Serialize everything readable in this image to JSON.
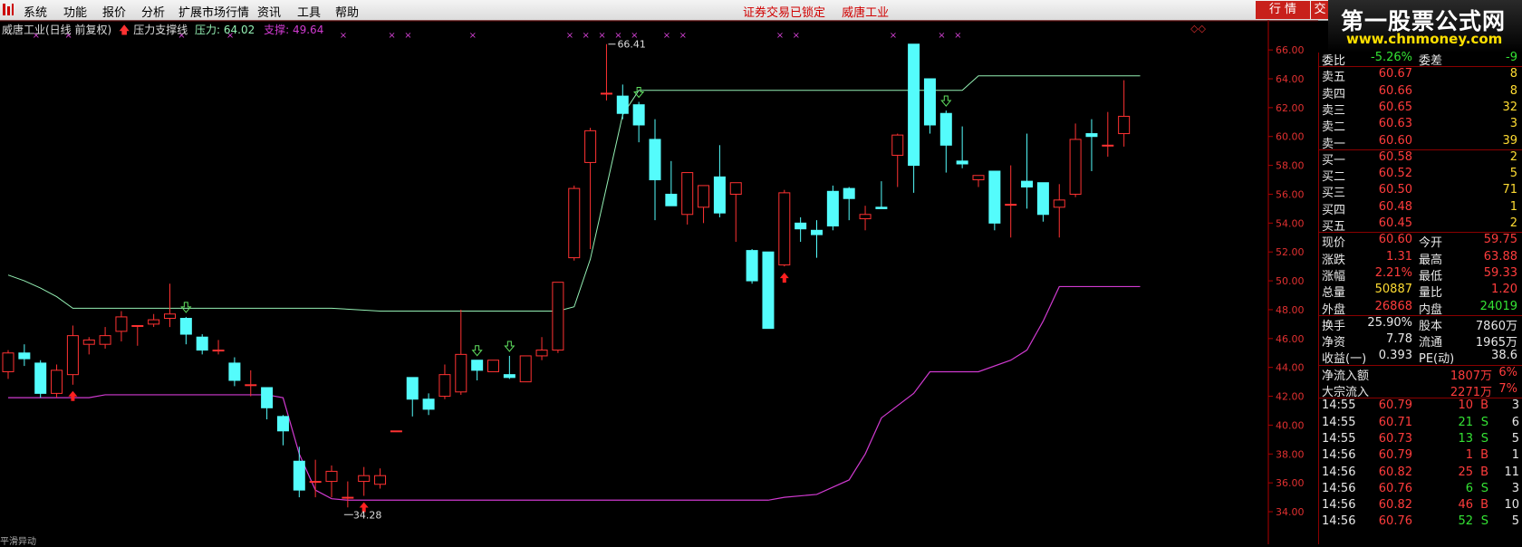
{
  "menu": [
    {
      "label": "系统"
    },
    {
      "label": "功能"
    },
    {
      "label": "报价"
    },
    {
      "label": "分析"
    },
    {
      "label": "扩展市场行情"
    },
    {
      "label": "资讯"
    },
    {
      "label": "工具"
    },
    {
      "label": "帮助"
    }
  ],
  "status": {
    "lock": "证券交易已锁定",
    "stock": "威唐工业"
  },
  "top_tabs": {
    "quote": "行 情",
    "trade": "交"
  },
  "watermark": {
    "title": "第一股票公式网",
    "url": "www.chnmoney.com"
  },
  "chart_header": {
    "stock": "威唐工业(日线 前复权)",
    "indicator": "压力支撑线",
    "pressure_label": "压力:",
    "pressure_value": "64.02",
    "support_label": "支撑:",
    "support_value": "49.64"
  },
  "indicator_nav": "◇◇",
  "colors": {
    "up": "#ff3232",
    "down": "#54fcfc",
    "pressure": "#94f0b4",
    "support": "#d03ad0",
    "axis": "#b00000"
  },
  "chart_data": {
    "type": "candlestick",
    "ylim": [
      33.5,
      67.2
    ],
    "yticks": [
      "66.00",
      "64.00",
      "62.00",
      "60.00",
      "58.00",
      "56.00",
      "54.00",
      "52.00",
      "50.00",
      "48.00",
      "46.00",
      "44.00",
      "42.00",
      "40.00",
      "38.00",
      "36.00",
      "34.00"
    ],
    "annotations": [
      {
        "text": "66.41",
        "index": 37
      },
      {
        "text": "34.28",
        "index": 21
      }
    ],
    "candles": [
      [
        43.7,
        45.2,
        43.2,
        45.0
      ],
      [
        45.0,
        45.6,
        44.1,
        44.6
      ],
      [
        44.3,
        44.5,
        41.9,
        42.2
      ],
      [
        42.2,
        44.2,
        41.9,
        43.8
      ],
      [
        43.5,
        46.9,
        42.8,
        46.2
      ],
      [
        45.6,
        46.1,
        44.9,
        45.9
      ],
      [
        45.6,
        46.8,
        45.3,
        46.2
      ],
      [
        46.5,
        47.9,
        45.8,
        47.5
      ],
      [
        46.9,
        46.9,
        45.5,
        46.9
      ],
      [
        47.0,
        47.7,
        46.8,
        47.3
      ],
      [
        47.4,
        49.8,
        46.8,
        47.7
      ],
      [
        47.4,
        47.5,
        45.6,
        46.3
      ],
      [
        46.1,
        46.3,
        44.9,
        45.2
      ],
      [
        45.2,
        45.9,
        44.9,
        45.2
      ],
      [
        44.3,
        44.7,
        42.7,
        43.1
      ],
      [
        42.8,
        43.8,
        42.0,
        42.8
      ],
      [
        42.6,
        42.6,
        40.4,
        41.2
      ],
      [
        40.6,
        40.7,
        38.6,
        39.6
      ],
      [
        37.5,
        38.5,
        35.0,
        35.5
      ],
      [
        36.1,
        37.6,
        35.0,
        36.1
      ],
      [
        36.1,
        37.2,
        35.0,
        36.8
      ],
      [
        35.0,
        36.1,
        34.3,
        35.0
      ],
      [
        36.1,
        37.1,
        35.1,
        36.5
      ],
      [
        35.9,
        37.0,
        35.6,
        36.5
      ],
      [
        39.6,
        39.6,
        39.6,
        39.6
      ],
      [
        43.3,
        43.3,
        40.6,
        41.8
      ],
      [
        41.8,
        42.2,
        40.7,
        41.1
      ],
      [
        42.0,
        44.2,
        41.8,
        43.5
      ],
      [
        42.3,
        48.0,
        42.1,
        44.9
      ],
      [
        44.5,
        44.5,
        43.1,
        43.8
      ],
      [
        43.7,
        44.5,
        43.7,
        44.5
      ],
      [
        43.5,
        44.8,
        43.2,
        43.3
      ],
      [
        43.0,
        44.4,
        43.0,
        44.8
      ],
      [
        44.8,
        46.1,
        44.5,
        45.2
      ],
      [
        45.2,
        49.9,
        45.0,
        49.9
      ],
      [
        51.6,
        56.6,
        51.4,
        56.4
      ],
      [
        58.2,
        60.6,
        52.2,
        60.4
      ],
      [
        63.0,
        66.4,
        62.5,
        63.0
      ],
      [
        62.8,
        63.6,
        61.2,
        61.6
      ],
      [
        62.2,
        62.4,
        59.6,
        60.8
      ],
      [
        59.8,
        61.2,
        54.2,
        57.0
      ],
      [
        56.0,
        58.3,
        55.3,
        55.2
      ],
      [
        54.6,
        57.2,
        53.9,
        57.5
      ],
      [
        55.1,
        56.5,
        54.0,
        56.6
      ],
      [
        57.2,
        59.4,
        54.4,
        54.7
      ],
      [
        56.0,
        56.6,
        52.7,
        56.8
      ],
      [
        52.1,
        52.2,
        49.8,
        50.0
      ],
      [
        52.0,
        52.0,
        46.7,
        46.7
      ],
      [
        51.1,
        56.3,
        51.0,
        56.1
      ],
      [
        54.0,
        54.4,
        52.7,
        53.6
      ],
      [
        53.5,
        54.2,
        51.6,
        53.2
      ],
      [
        56.2,
        56.6,
        53.5,
        53.8
      ],
      [
        56.4,
        56.5,
        54.2,
        55.7
      ],
      [
        54.3,
        55.2,
        53.5,
        54.6
      ],
      [
        55.1,
        56.9,
        55.0,
        55.0
      ],
      [
        58.7,
        60.2,
        56.5,
        60.1
      ],
      [
        66.4,
        66.4,
        56.1,
        58.0
      ],
      [
        64.0,
        64.0,
        60.2,
        60.8
      ],
      [
        61.6,
        61.8,
        57.5,
        59.4
      ],
      [
        58.3,
        60.7,
        57.8,
        58.1
      ],
      [
        57.0,
        57.0,
        56.5,
        57.3
      ],
      [
        57.6,
        57.6,
        53.5,
        54.0
      ],
      [
        55.3,
        58.0,
        53.0,
        55.3
      ],
      [
        56.9,
        60.2,
        55.0,
        56.5
      ],
      [
        56.8,
        56.8,
        54.1,
        54.6
      ],
      [
        55.1,
        56.7,
        53.0,
        55.6
      ],
      [
        56.0,
        60.9,
        55.8,
        59.8
      ],
      [
        60.2,
        61.2,
        57.6,
        60.0
      ],
      [
        59.4,
        61.7,
        58.6,
        59.4
      ],
      [
        60.2,
        63.9,
        59.3,
        61.4
      ]
    ],
    "pressure_line": [
      [
        0,
        50.4
      ],
      [
        1,
        50.0
      ],
      [
        2,
        49.5
      ],
      [
        3,
        48.9
      ],
      [
        4,
        48.1
      ],
      [
        5,
        48.1
      ],
      [
        10,
        48.1
      ],
      [
        20,
        48.1
      ],
      [
        23,
        47.9
      ],
      [
        34,
        47.9
      ],
      [
        35,
        48.2
      ],
      [
        36,
        51.5
      ],
      [
        37,
        56.5
      ],
      [
        38,
        61.5
      ],
      [
        39,
        63.2
      ],
      [
        55,
        63.2
      ],
      [
        58,
        63.2
      ],
      [
        59,
        63.2
      ],
      [
        60,
        64.2
      ],
      [
        70,
        64.2
      ]
    ],
    "support_line": [
      [
        0,
        41.9
      ],
      [
        5,
        41.9
      ],
      [
        6,
        42.1
      ],
      [
        10,
        42.1
      ],
      [
        16,
        42.1
      ],
      [
        17,
        41.9
      ],
      [
        18,
        38.0
      ],
      [
        19,
        35.5
      ],
      [
        20,
        34.9
      ],
      [
        21,
        34.8
      ],
      [
        47,
        34.8
      ],
      [
        48,
        35.0
      ],
      [
        50,
        35.2
      ],
      [
        51,
        35.7
      ],
      [
        52,
        36.2
      ],
      [
        53,
        38.0
      ],
      [
        54,
        40.5
      ],
      [
        56,
        42.2
      ],
      [
        57,
        43.7
      ],
      [
        60,
        43.7
      ],
      [
        62,
        44.5
      ],
      [
        63,
        45.2
      ],
      [
        64,
        47.2
      ],
      [
        65,
        49.6
      ],
      [
        66,
        49.6
      ],
      [
        70,
        49.6
      ]
    ],
    "up_signals": [
      4,
      22,
      48
    ],
    "down_signals": [
      11,
      29,
      31,
      39,
      58
    ],
    "x_marks": [
      1,
      3,
      10,
      13,
      20,
      23,
      24,
      28,
      34,
      35,
      36,
      37,
      38,
      40,
      41,
      47,
      48,
      54,
      57,
      58
    ]
  },
  "panel": {
    "rows": [
      {
        "type": "ratio",
        "label": "委比",
        "value": "-5.26%",
        "label2": "委差",
        "value2": "-9"
      },
      {
        "type": "book",
        "label": "卖五",
        "price": "60.67",
        "qty": "8"
      },
      {
        "type": "book",
        "label": "卖四",
        "price": "60.66",
        "qty": "8"
      },
      {
        "type": "book",
        "label": "卖三",
        "price": "60.65",
        "qty": "32"
      },
      {
        "type": "book",
        "label": "卖二",
        "price": "60.63",
        "qty": "3"
      },
      {
        "type": "book",
        "label": "卖一",
        "price": "60.60",
        "qty": "39"
      },
      {
        "type": "book",
        "label": "买一",
        "price": "60.58",
        "qty": "2"
      },
      {
        "type": "book",
        "label": "买二",
        "price": "60.52",
        "qty": "5"
      },
      {
        "type": "book",
        "label": "买三",
        "price": "60.50",
        "qty": "71"
      },
      {
        "type": "book",
        "label": "买四",
        "price": "60.48",
        "qty": "1"
      },
      {
        "type": "book",
        "label": "买五",
        "price": "60.45",
        "qty": "2"
      },
      {
        "type": "kv2",
        "label": "现价",
        "value": "60.60",
        "label2": "今开",
        "value2": "59.75"
      },
      {
        "type": "kv2",
        "label": "涨跌",
        "value": "1.31",
        "label2": "最高",
        "value2": "63.88"
      },
      {
        "type": "kv2",
        "label": "涨幅",
        "value": "2.21%",
        "label2": "最低",
        "value2": "59.33"
      },
      {
        "type": "kv2",
        "label": "总量",
        "value": "50887",
        "label2": "量比",
        "value2": "1.20"
      },
      {
        "type": "kv2",
        "label": "外盘",
        "value": "26868",
        "label2": "内盘",
        "value2": "24019"
      },
      {
        "type": "kv2",
        "label": "换手",
        "value": "25.90%",
        "label2": "股本",
        "value2": "7860万"
      },
      {
        "type": "kv2",
        "label": "净资",
        "value": "7.78",
        "label2": "流通",
        "value2": "1965万"
      },
      {
        "type": "kv2",
        "label": "收益(一)",
        "value": "0.393",
        "label2": "PE(动)",
        "value2": "38.6"
      },
      {
        "type": "flow",
        "label": "净流入额",
        "value": "1807万",
        "pct": "6%"
      },
      {
        "type": "flow",
        "label": "大宗流入",
        "value": "2271万",
        "pct": "7%"
      },
      {
        "type": "tick",
        "time": "14:55",
        "price": "60.79",
        "vol": "10",
        "bs": "B",
        "n": "3"
      },
      {
        "type": "tick",
        "time": "14:55",
        "price": "60.71",
        "vol": "21",
        "bs": "S",
        "n": "6"
      },
      {
        "type": "tick",
        "time": "14:55",
        "price": "60.73",
        "vol": "13",
        "bs": "S",
        "n": "5"
      },
      {
        "type": "tick",
        "time": "14:56",
        "price": "60.79",
        "vol": "1",
        "bs": "B",
        "n": "1"
      },
      {
        "type": "tick",
        "time": "14:56",
        "price": "60.82",
        "vol": "25",
        "bs": "B",
        "n": "11"
      },
      {
        "type": "tick",
        "time": "14:56",
        "price": "60.76",
        "vol": "6",
        "bs": "S",
        "n": "3"
      },
      {
        "type": "tick",
        "time": "14:56",
        "price": "60.82",
        "vol": "46",
        "bs": "B",
        "n": "10"
      },
      {
        "type": "tick",
        "time": "14:56",
        "price": "60.76",
        "vol": "52",
        "bs": "S",
        "n": "5"
      }
    ]
  },
  "bottom_label": "平滑异动"
}
